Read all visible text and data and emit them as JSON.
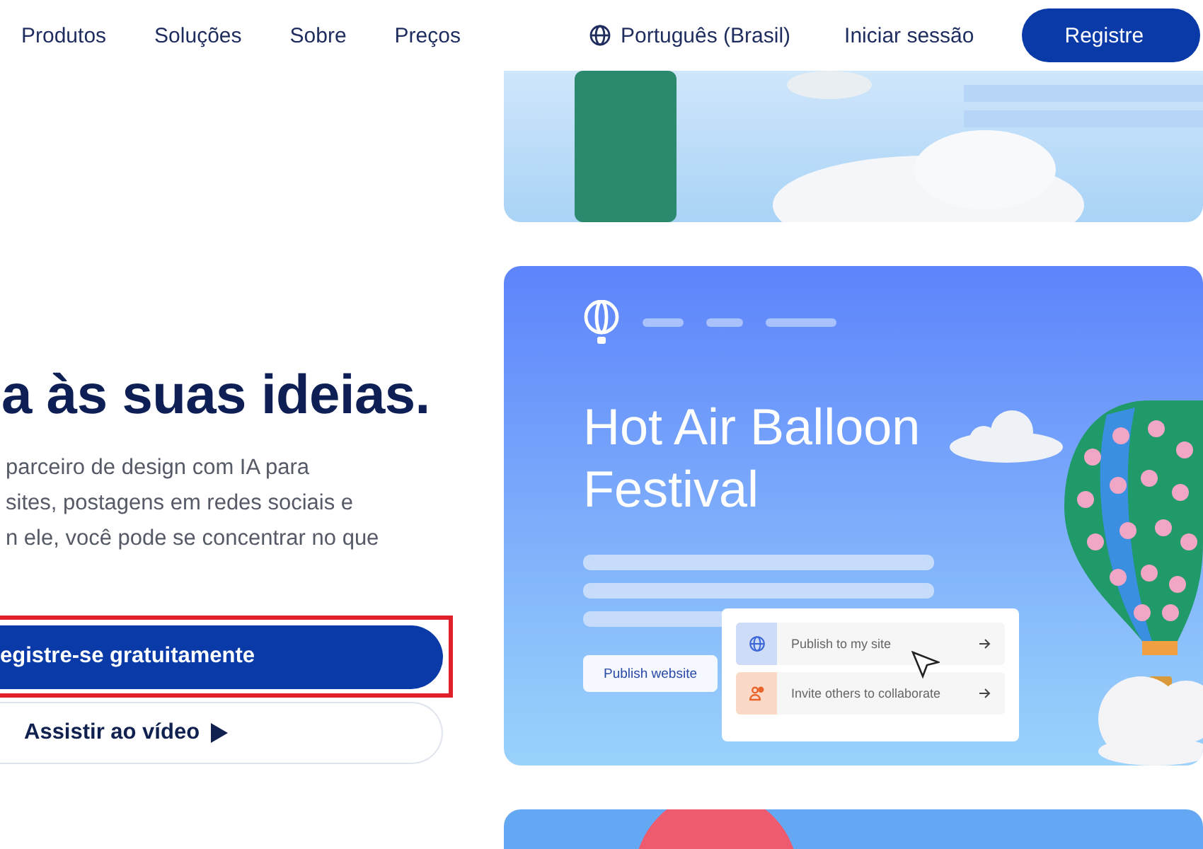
{
  "nav": {
    "links": [
      "Produtos",
      "Soluções",
      "Sobre",
      "Preços"
    ],
    "language": "Português (Brasil)",
    "login": "Iniciar sessão",
    "signup": "Registre"
  },
  "hero": {
    "headline": "a às suas ideias.",
    "body_lines": [
      "parceiro de design com IA para",
      "sites, postagens em redes sociais e",
      "n ele, você pode se concentrar no que"
    ],
    "primary_button": "egistre-se gratuitamente",
    "video_button": "Assistir ao vídeo"
  },
  "preview": {
    "title": "Hot Air Balloon Festival",
    "publish_button": "Publish website",
    "options": [
      {
        "label": "Publish to my site",
        "kind": "publish"
      },
      {
        "label": "Invite others to collaborate",
        "kind": "invite"
      }
    ]
  }
}
